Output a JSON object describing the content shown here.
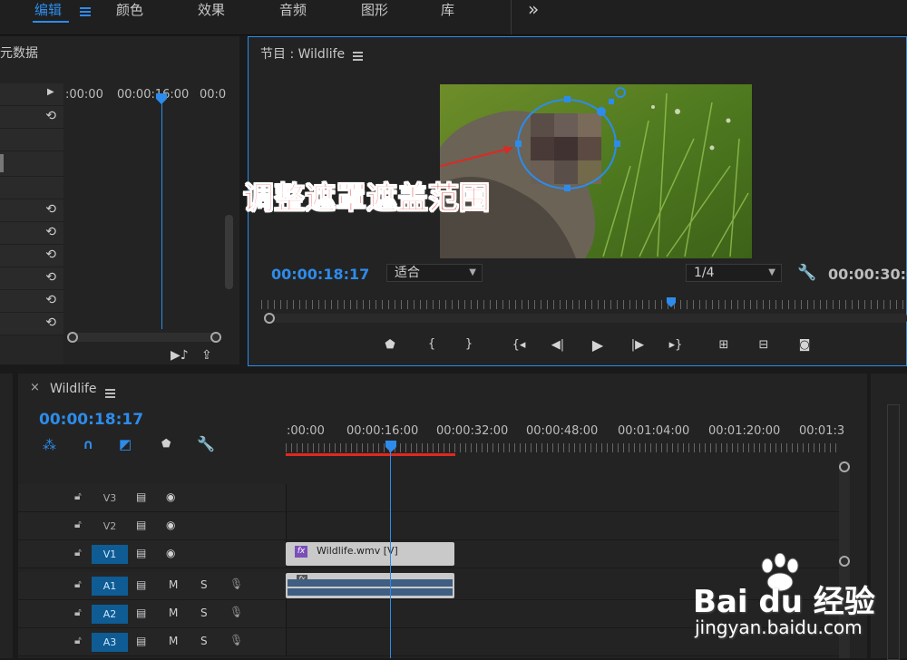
{
  "workspaces": {
    "tabs": [
      "编辑",
      "颜色",
      "效果",
      "音频",
      "图形",
      "库"
    ],
    "more_label": "»"
  },
  "metadata_panel": {
    "title": "元数据",
    "ruler": [
      ":00:00",
      "00:00:16:00",
      "00:0"
    ]
  },
  "program_monitor": {
    "title": "节目 : Wildlife",
    "current_time": "00:00:18:17",
    "fit_value": "适合",
    "resolution_value": "1/4",
    "total_time": "00:00:30:0",
    "annotation": "调整遮罩遮盖范围"
  },
  "timeline": {
    "tab_title": "Wildlife",
    "close_label": "×",
    "current_time": "00:00:18:17",
    "ruler": [
      ":00:00",
      "00:00:16:00",
      "00:00:32:00",
      "00:00:48:00",
      "00:01:04:00",
      "00:01:20:00",
      "00:01:3"
    ],
    "tracks": [
      {
        "name": "V3",
        "type": "video"
      },
      {
        "name": "V2",
        "type": "video"
      },
      {
        "name": "V1",
        "type": "video",
        "selected": true
      },
      {
        "name": "A1",
        "type": "audio",
        "selected": true
      },
      {
        "name": "A2",
        "type": "audio",
        "selected": true
      },
      {
        "name": "A3",
        "type": "audio",
        "selected": true
      }
    ],
    "mute_label": "M",
    "solo_label": "S",
    "video_clip_label": "Wildlife.wmv [V]",
    "fx_label": "fx"
  },
  "watermark": {
    "brand": "Bai du 经验",
    "url": "jingyan.baidu.com"
  },
  "colors": {
    "accent": "#2d8ceb",
    "track_selected": "#0e5c93",
    "work_area": "#e0281f"
  }
}
